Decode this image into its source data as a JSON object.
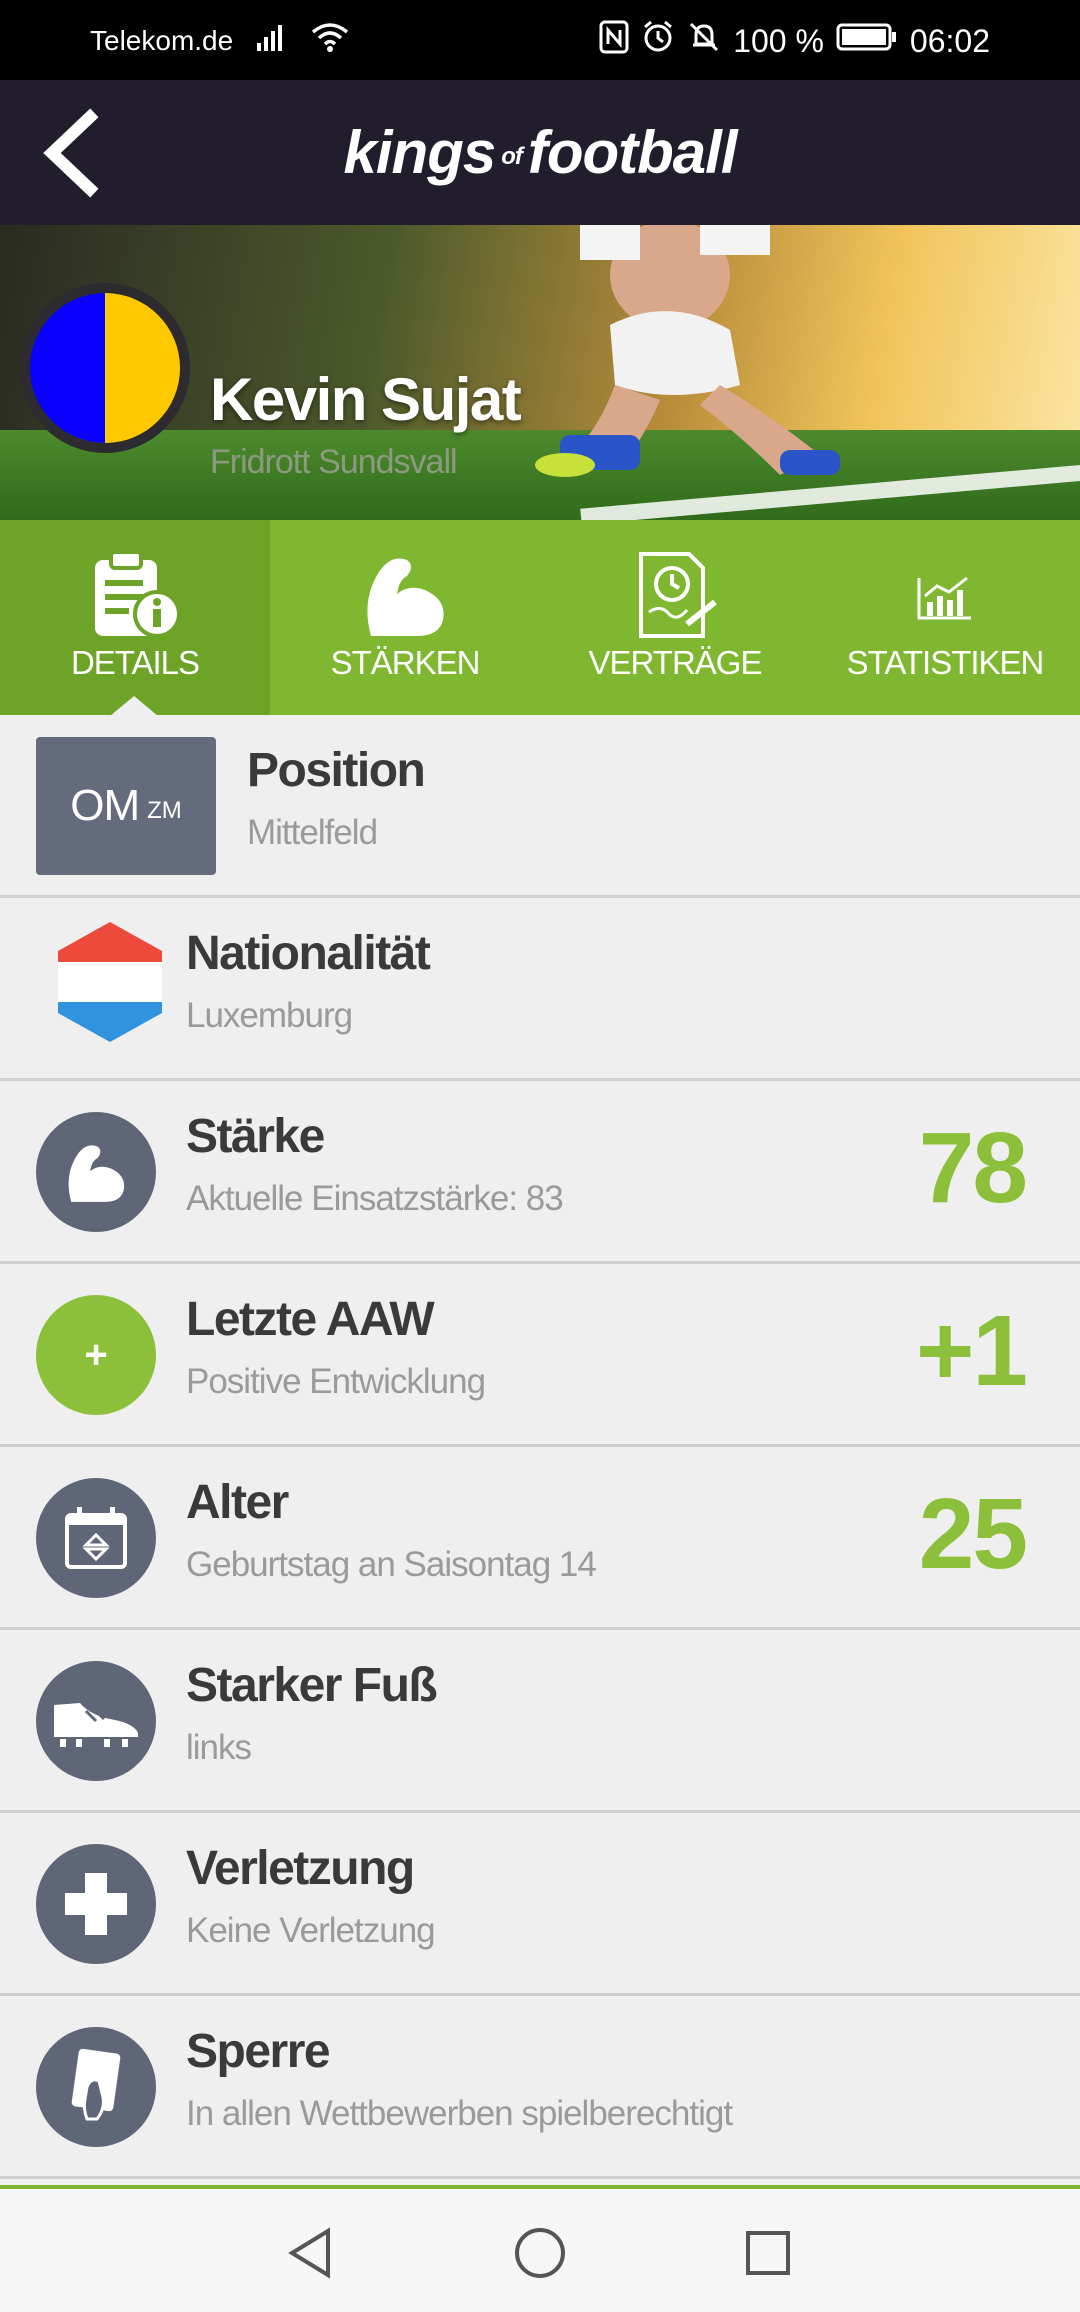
{
  "status_bar": {
    "carrier": "Telekom.de",
    "battery": "100 %",
    "time": "06:02"
  },
  "header": {
    "logo_kings": "kings",
    "logo_of": "of",
    "logo_football": "football"
  },
  "player": {
    "name": "Kevin Sujat",
    "club": "Fridrott Sundsvall",
    "crest_colors": [
      "#0a00ff",
      "#ffc800"
    ]
  },
  "tabs": [
    {
      "label": "DETAILS",
      "icon": "clipboard-info-icon",
      "active": true
    },
    {
      "label": "STÄRKEN",
      "icon": "flexed-arm-icon",
      "active": false
    },
    {
      "label": "VERTRÄGE",
      "icon": "contract-clock-icon",
      "active": false
    },
    {
      "label": "STATISTIKEN",
      "icon": "chart-icon",
      "active": false
    }
  ],
  "details": {
    "position": {
      "title": "Position",
      "sub": "Mittelfeld",
      "code": "OM",
      "secondary_code": "ZM"
    },
    "nationality": {
      "title": "Nationalität",
      "sub": "Luxemburg",
      "flag_colors": [
        "#ed4a3c",
        "#ffffff",
        "#2f93de"
      ]
    },
    "strength": {
      "title": "Stärke",
      "sub": "Aktuelle Einsatzstärke: 83",
      "value": "78"
    },
    "last_aaw": {
      "title": "Letzte AAW",
      "sub": "Positive Entwicklung",
      "value": "+1",
      "icon_symbol": "+"
    },
    "age": {
      "title": "Alter",
      "sub": "Geburtstag an Saisontag 14",
      "value": "25"
    },
    "strong_foot": {
      "title": "Starker Fuß",
      "sub": "links"
    },
    "injury": {
      "title": "Verletzung",
      "sub": "Keine Verletzung"
    },
    "suspension": {
      "title": "Sperre",
      "sub": "In allen Wettbewerben spielberechtigt"
    }
  },
  "colors": {
    "accent_green": "#80b730",
    "value_green": "#8dc03a",
    "header_dark": "#221d2c",
    "icon_gray": "#5f6678"
  }
}
